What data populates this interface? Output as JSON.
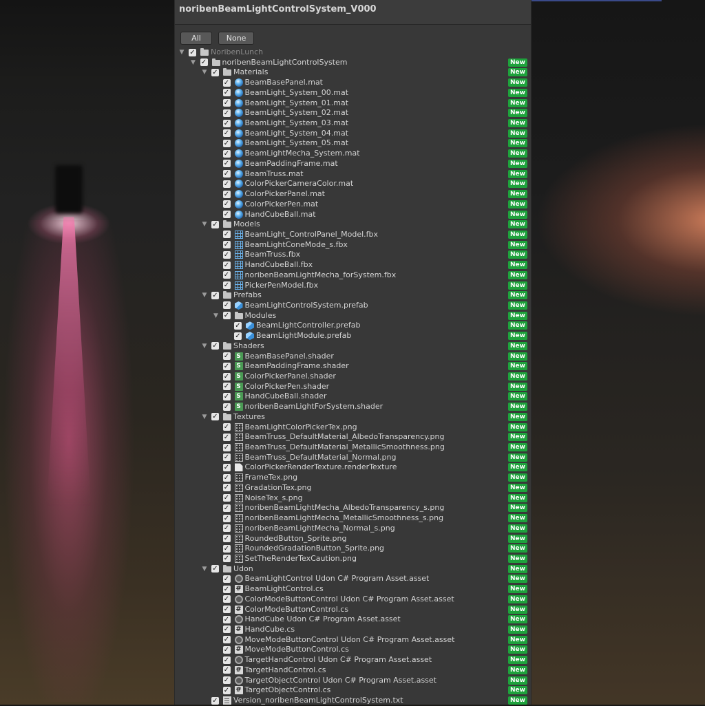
{
  "window": {
    "title": "noribenBeamLightControlSystem_V000"
  },
  "buttons": {
    "all": "All",
    "none": "None"
  },
  "badge_text": "New",
  "colors": {
    "panel_bg": "#383838",
    "badge_green": "#1ea23c",
    "text": "#d4d4d4"
  },
  "tree": [
    {
      "label": "NoribenLunch",
      "depth": 0,
      "icon": "folder-icon",
      "foldout": true,
      "checked": true,
      "dim": true,
      "new": false
    },
    {
      "label": "noribenBeamLightControlSystem",
      "depth": 1,
      "icon": "folder-icon",
      "foldout": true,
      "checked": true,
      "new": true
    },
    {
      "label": "Materials",
      "depth": 2,
      "icon": "folder-icon",
      "foldout": true,
      "checked": true,
      "new": true
    },
    {
      "label": "BeamBasePanel.mat",
      "depth": 3,
      "icon": "material-icon",
      "checked": true,
      "new": true
    },
    {
      "label": "BeamLight_System_00.mat",
      "depth": 3,
      "icon": "material-icon",
      "checked": true,
      "new": true
    },
    {
      "label": "BeamLight_System_01.mat",
      "depth": 3,
      "icon": "material-icon",
      "checked": true,
      "new": true
    },
    {
      "label": "BeamLight_System_02.mat",
      "depth": 3,
      "icon": "material-icon",
      "checked": true,
      "new": true
    },
    {
      "label": "BeamLight_System_03.mat",
      "depth": 3,
      "icon": "material-icon",
      "checked": true,
      "new": true
    },
    {
      "label": "BeamLight_System_04.mat",
      "depth": 3,
      "icon": "material-icon",
      "checked": true,
      "new": true
    },
    {
      "label": "BeamLight_System_05.mat",
      "depth": 3,
      "icon": "material-icon",
      "checked": true,
      "new": true
    },
    {
      "label": "BeamLightMecha_System.mat",
      "depth": 3,
      "icon": "material-icon",
      "checked": true,
      "new": true
    },
    {
      "label": "BeamPaddingFrame.mat",
      "depth": 3,
      "icon": "material-icon",
      "checked": true,
      "new": true
    },
    {
      "label": "BeamTruss.mat",
      "depth": 3,
      "icon": "material-icon",
      "checked": true,
      "new": true
    },
    {
      "label": "ColorPickerCameraColor.mat",
      "depth": 3,
      "icon": "material-icon",
      "checked": true,
      "new": true
    },
    {
      "label": "ColorPickerPanel.mat",
      "depth": 3,
      "icon": "material-icon",
      "checked": true,
      "new": true
    },
    {
      "label": "ColorPickerPen.mat",
      "depth": 3,
      "icon": "material-icon",
      "checked": true,
      "new": true
    },
    {
      "label": "HandCubeBall.mat",
      "depth": 3,
      "icon": "material-icon",
      "checked": true,
      "new": true
    },
    {
      "label": "Models",
      "depth": 2,
      "icon": "folder-icon",
      "foldout": true,
      "checked": true,
      "new": true
    },
    {
      "label": "BeamLight_ControlPanel_Model.fbx",
      "depth": 3,
      "icon": "model-icon",
      "checked": true,
      "new": true
    },
    {
      "label": "BeamLightConeMode_s.fbx",
      "depth": 3,
      "icon": "model-icon",
      "checked": true,
      "new": true
    },
    {
      "label": "BeamTruss.fbx",
      "depth": 3,
      "icon": "model-icon",
      "checked": true,
      "new": true
    },
    {
      "label": "HandCubeBall.fbx",
      "depth": 3,
      "icon": "model-icon",
      "checked": true,
      "new": true
    },
    {
      "label": "noribenBeamLightMecha_forSystem.fbx",
      "depth": 3,
      "icon": "model-icon",
      "checked": true,
      "new": true
    },
    {
      "label": "PickerPenModel.fbx",
      "depth": 3,
      "icon": "model-icon",
      "checked": true,
      "new": true
    },
    {
      "label": "Prefabs",
      "depth": 2,
      "icon": "folder-icon",
      "foldout": true,
      "checked": true,
      "new": true
    },
    {
      "label": "BeamLightControlSystem.prefab",
      "depth": 3,
      "icon": "prefab-icon",
      "checked": true,
      "new": true
    },
    {
      "label": "Modules",
      "depth": 3,
      "icon": "folder-icon",
      "foldout": true,
      "checked": true,
      "new": true
    },
    {
      "label": "BeamLightController.prefab",
      "depth": 4,
      "icon": "prefab-icon",
      "checked": true,
      "new": true
    },
    {
      "label": "BeamLightModule.prefab",
      "depth": 4,
      "icon": "prefab-icon",
      "checked": true,
      "new": true
    },
    {
      "label": "Shaders",
      "depth": 2,
      "icon": "folder-icon",
      "foldout": true,
      "checked": true,
      "new": true
    },
    {
      "label": "BeamBasePanel.shader",
      "depth": 3,
      "icon": "shader-icon",
      "checked": true,
      "new": true
    },
    {
      "label": "BeamPaddingFrame.shader",
      "depth": 3,
      "icon": "shader-icon",
      "checked": true,
      "new": true
    },
    {
      "label": "ColorPickerPanel.shader",
      "depth": 3,
      "icon": "shader-icon",
      "checked": true,
      "new": true
    },
    {
      "label": "ColorPickerPen.shader",
      "depth": 3,
      "icon": "shader-icon",
      "checked": true,
      "new": true
    },
    {
      "label": "HandCubeBall.shader",
      "depth": 3,
      "icon": "shader-icon",
      "checked": true,
      "new": true
    },
    {
      "label": "noribenBeamLightForSystem.shader",
      "depth": 3,
      "icon": "shader-icon",
      "checked": true,
      "new": true
    },
    {
      "label": "Textures",
      "depth": 2,
      "icon": "folder-icon",
      "foldout": true,
      "checked": true,
      "new": true
    },
    {
      "label": "BeamLightColorPickerTex.png",
      "depth": 3,
      "icon": "texture-icon",
      "checked": true,
      "new": true
    },
    {
      "label": "BeamTruss_DefaultMaterial_AlbedoTransparency.png",
      "depth": 3,
      "icon": "texture-icon",
      "checked": true,
      "new": true
    },
    {
      "label": "BeamTruss_DefaultMaterial_MetallicSmoothness.png",
      "depth": 3,
      "icon": "texture-icon",
      "checked": true,
      "new": true
    },
    {
      "label": "BeamTruss_DefaultMaterial_Normal.png",
      "depth": 3,
      "icon": "texture-icon",
      "checked": true,
      "new": true
    },
    {
      "label": "ColorPickerRenderTexture.renderTexture",
      "depth": 3,
      "icon": "render-texture-icon",
      "checked": true,
      "new": true
    },
    {
      "label": "FrameTex.png",
      "depth": 3,
      "icon": "texture-icon",
      "checked": true,
      "new": true
    },
    {
      "label": "GradationTex.png",
      "depth": 3,
      "icon": "texture-icon",
      "checked": true,
      "new": true
    },
    {
      "label": "NoiseTex_s.png",
      "depth": 3,
      "icon": "texture-icon",
      "checked": true,
      "new": true
    },
    {
      "label": "noribenBeamLightMecha_AlbedoTransparency_s.png",
      "depth": 3,
      "icon": "texture-icon",
      "checked": true,
      "new": true
    },
    {
      "label": "noribenBeamLightMecha_MetallicSmoothness_s.png",
      "depth": 3,
      "icon": "texture-icon",
      "checked": true,
      "new": true
    },
    {
      "label": "noribenBeamLightMecha_Normal_s.png",
      "depth": 3,
      "icon": "texture-icon",
      "checked": true,
      "new": true
    },
    {
      "label": "RoundedButton_Sprite.png",
      "depth": 3,
      "icon": "texture-icon",
      "checked": true,
      "new": true
    },
    {
      "label": "RoundedGradationButton_Sprite.png",
      "depth": 3,
      "icon": "texture-icon",
      "checked": true,
      "new": true
    },
    {
      "label": "SetTheRenderTexCaution.png",
      "depth": 3,
      "icon": "texture-icon",
      "checked": true,
      "new": true
    },
    {
      "label": "Udon",
      "depth": 2,
      "icon": "folder-icon",
      "foldout": true,
      "checked": true,
      "new": true
    },
    {
      "label": "BeamLightControl Udon C# Program Asset.asset",
      "depth": 3,
      "icon": "asset-icon",
      "checked": true,
      "new": true
    },
    {
      "label": "BeamLightControl.cs",
      "depth": 3,
      "icon": "csharp-icon",
      "checked": true,
      "new": true
    },
    {
      "label": "ColorModeButtonControl Udon C# Program Asset.asset",
      "depth": 3,
      "icon": "asset-icon",
      "checked": true,
      "new": true
    },
    {
      "label": "ColorModeButtonControl.cs",
      "depth": 3,
      "icon": "csharp-icon",
      "checked": true,
      "new": true
    },
    {
      "label": "HandCube Udon C# Program Asset.asset",
      "depth": 3,
      "icon": "asset-icon",
      "checked": true,
      "new": true
    },
    {
      "label": "HandCube.cs",
      "depth": 3,
      "icon": "csharp-icon",
      "checked": true,
      "new": true
    },
    {
      "label": "MoveModeButtonControl Udon C# Program Asset.asset",
      "depth": 3,
      "icon": "asset-icon",
      "checked": true,
      "new": true
    },
    {
      "label": "MoveModeButtonControl.cs",
      "depth": 3,
      "icon": "csharp-icon",
      "checked": true,
      "new": true
    },
    {
      "label": "TargetHandControl Udon C# Program Asset.asset",
      "depth": 3,
      "icon": "asset-icon",
      "checked": true,
      "new": true
    },
    {
      "label": "TargetHandControl.cs",
      "depth": 3,
      "icon": "csharp-icon",
      "checked": true,
      "new": true
    },
    {
      "label": "TargetObjectControl Udon C# Program Asset.asset",
      "depth": 3,
      "icon": "asset-icon",
      "checked": true,
      "new": true
    },
    {
      "label": "TargetObjectControl.cs",
      "depth": 3,
      "icon": "csharp-icon",
      "checked": true,
      "new": true
    },
    {
      "label": "Version_noribenBeamLightControlSystem.txt",
      "depth": 2,
      "icon": "text-file-icon",
      "checked": true,
      "new": true
    }
  ]
}
